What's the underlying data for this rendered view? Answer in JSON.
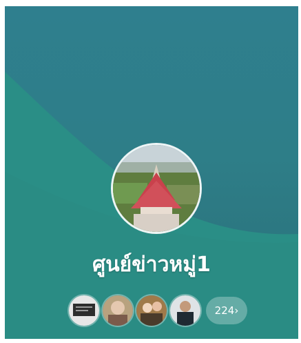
{
  "group": {
    "name": "ศูนย์ข่าวหมู่1"
  },
  "members": {
    "more_count": "224",
    "more_chevron": "›",
    "avatars": [
      "member-avatar-1",
      "member-avatar-2",
      "member-avatar-3",
      "member-avatar-4"
    ]
  },
  "colors": {
    "background": "#2f7f8e",
    "wave": "#2b8f86",
    "text": "#ffffff"
  }
}
